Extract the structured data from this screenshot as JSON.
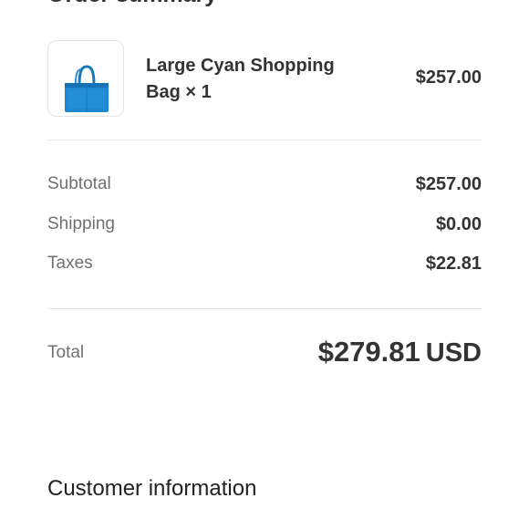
{
  "order_summary": {
    "title": "Order summary",
    "line_items": [
      {
        "name": "Large Cyan Shopping Bag × 1",
        "price": "$257.00",
        "thumbnail_icon": "shopping-bag-icon",
        "thumbnail_color": "#1e88d0"
      }
    ],
    "subtotal": {
      "label": "Subtotal",
      "value": "$257.00"
    },
    "shipping": {
      "label": "Shipping",
      "value": "$0.00"
    },
    "taxes": {
      "label": "Taxes",
      "value": "$22.81"
    },
    "total": {
      "label": "Total",
      "amount": "$279.81",
      "currency": "USD"
    }
  },
  "customer_information": {
    "title": "Customer information"
  }
}
